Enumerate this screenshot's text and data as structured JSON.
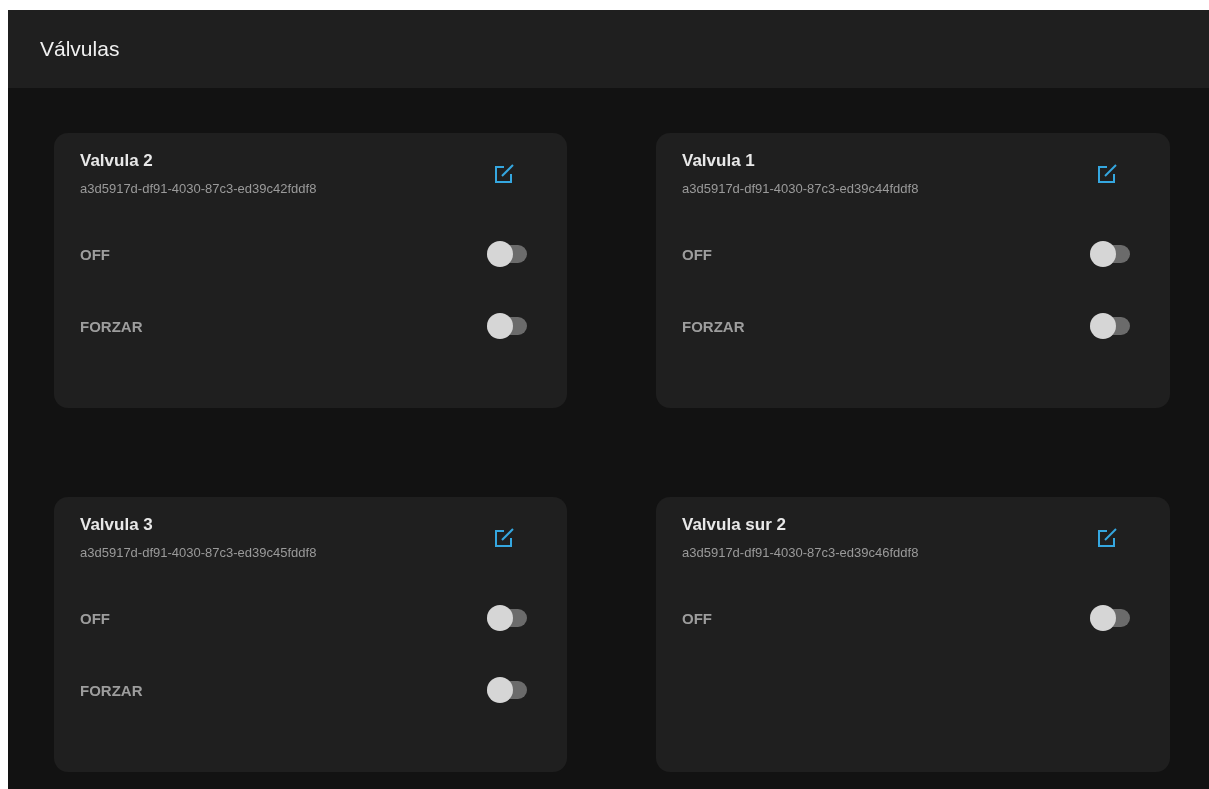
{
  "header": {
    "title": "Válvulas"
  },
  "valves": [
    {
      "name": "Valvula 2",
      "id": "a3d5917d-df91-4030-87c3-ed39c42fddf8",
      "switches": [
        {
          "label": "OFF",
          "on": false
        },
        {
          "label": "FORZAR",
          "on": false
        }
      ]
    },
    {
      "name": "Valvula 1",
      "id": "a3d5917d-df91-4030-87c3-ed39c44fddf8",
      "switches": [
        {
          "label": "OFF",
          "on": false
        },
        {
          "label": "FORZAR",
          "on": false
        }
      ]
    },
    {
      "name": "Valvula 3",
      "id": "a3d5917d-df91-4030-87c3-ed39c45fddf8",
      "switches": [
        {
          "label": "OFF",
          "on": false
        },
        {
          "label": "FORZAR",
          "on": false
        }
      ]
    },
    {
      "name": "Valvula sur 2",
      "id": "a3d5917d-df91-4030-87c3-ed39c46fddf8",
      "switches": [
        {
          "label": "OFF",
          "on": false
        }
      ]
    }
  ]
}
